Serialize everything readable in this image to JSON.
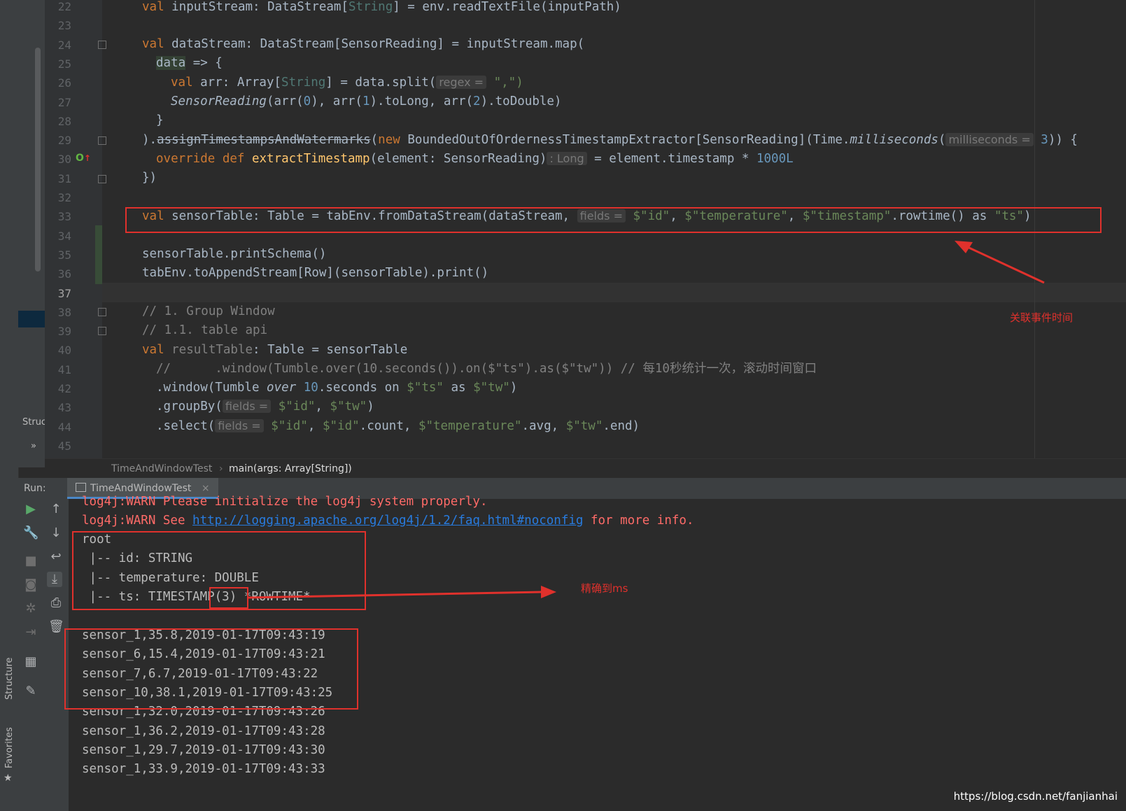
{
  "code_lines": [
    {
      "n": "22"
    },
    {
      "n": "23"
    },
    {
      "n": "24"
    },
    {
      "n": "25"
    },
    {
      "n": "26"
    },
    {
      "n": "27"
    },
    {
      "n": "28"
    },
    {
      "n": "29"
    },
    {
      "n": "30"
    },
    {
      "n": "31"
    },
    {
      "n": "32"
    },
    {
      "n": "33"
    },
    {
      "n": "34"
    },
    {
      "n": "35"
    },
    {
      "n": "36"
    },
    {
      "n": "37"
    },
    {
      "n": "38"
    },
    {
      "n": "39"
    },
    {
      "n": "40"
    },
    {
      "n": "41"
    },
    {
      "n": "42"
    },
    {
      "n": "43"
    },
    {
      "n": "44"
    },
    {
      "n": "45"
    }
  ],
  "code": {
    "l22": [
      "val",
      " inputStream: DataStream[",
      "String",
      "] = env.readTextFile(inputPath)"
    ],
    "l24": [
      "val",
      " dataStream: DataStream[SensorReading] = inputStream.map("
    ],
    "l25": [
      "data",
      " => {"
    ],
    "l26": [
      "val",
      " arr: Array[",
      "String",
      "] = data.split(",
      "regex =",
      " \",\")"
    ],
    "l27": [
      "SensorReading",
      "(arr(",
      "0",
      "), arr(",
      "1",
      ").toLong, arr(",
      "2",
      ").toDouble)"
    ],
    "l28": [
      "}"
    ],
    "l29": [
      ").",
      "assignTimestampsAndWatermarks",
      "(",
      "new",
      " BoundedOutOfOrdernessTimestampExtractor[SensorReading](Time.",
      "milliseconds",
      "(",
      "milliseconds =",
      " ",
      "3",
      ")) {"
    ],
    "l30": [
      "override def",
      " ",
      "extractTimestamp",
      "(element: SensorReading)",
      ": Long",
      " = element.timestamp * ",
      "1000L"
    ],
    "l31": [
      "})"
    ],
    "l33": [
      "val",
      " sensorTable: Table = tabEnv.fromDataStream(dataStream, ",
      "fields =",
      " $\"id\"",
      ", ",
      "$\"temperature\"",
      ", ",
      "$\"timestamp\"",
      ".rowtime() as ",
      "\"ts\"",
      ")"
    ],
    "l35": [
      "sensorTable.printSchema()"
    ],
    "l36": [
      "tabEnv.toAppendStream[Row](sensorTable).print()"
    ],
    "l38": [
      "// 1. Group Window"
    ],
    "l39": [
      "// 1.1. table api"
    ],
    "l40": [
      "val",
      " resultTable",
      ": Table = sensorTable"
    ],
    "l41": [
      "//      .window(Tumble.over(10.seconds()).on($\"ts\").as($\"tw\")) // 每10秒统计一次，滚动时间窗口"
    ],
    "l42": [
      ".window(Tumble ",
      "over",
      " ",
      "10",
      ".seconds on ",
      "$\"ts\"",
      " as ",
      "$\"tw\"",
      ")"
    ],
    "l43": [
      ".groupBy(",
      "fields =",
      " ",
      "$\"id\"",
      ", ",
      "$\"tw\"",
      ")"
    ],
    "l44": [
      ".select(",
      "fields =",
      " ",
      "$\"id\"",
      ", ",
      "$\"id\"",
      ".count, ",
      "$\"temperature\"",
      ".avg, ",
      "$\"tw\"",
      ".end)"
    ]
  },
  "breadcrumb": {
    "item1": "TimeAndWindowTest",
    "item2": "main(args: Array[String])"
  },
  "structure_tab": "Struc",
  "run": {
    "label": "Run:",
    "tab": "TimeAndWindowTest"
  },
  "console": {
    "warn1": "log4j:WARN Please initialize the log4j system properly.",
    "warn2_pre": "log4j:WARN See ",
    "warn2_link": "http://logging.apache.org/log4j/1.2/faq.html#noconfig",
    "warn2_post": " for more info.",
    "schema": [
      "root",
      " |-- id: STRING",
      " |-- temperature: DOUBLE",
      " |-- ts: TIMESTAMP(3) *ROWTIME*"
    ],
    "rows": [
      "sensor_1,35.8,2019-01-17T09:43:19",
      "sensor_6,15.4,2019-01-17T09:43:21",
      "sensor_7,6.7,2019-01-17T09:43:22",
      "sensor_10,38.1,2019-01-17T09:43:25",
      "sensor_1,32.0,2019-01-17T09:43:26",
      "sensor_1,36.2,2019-01-17T09:43:28",
      "sensor_1,29.7,2019-01-17T09:43:30",
      "sensor_1,33.9,2019-01-17T09:43:33"
    ]
  },
  "annotations": {
    "event_time": "关联事件时间",
    "ms": "精确到ms"
  },
  "side_tabs": {
    "structure": "Structure",
    "favorites": "Favorites"
  },
  "watermark": "https://blog.csdn.net/fanjianhai",
  "colors": {
    "annotation_red": "#e0312c",
    "keyword": "#cc7832",
    "string": "#6a8759",
    "number": "#6897bb"
  }
}
